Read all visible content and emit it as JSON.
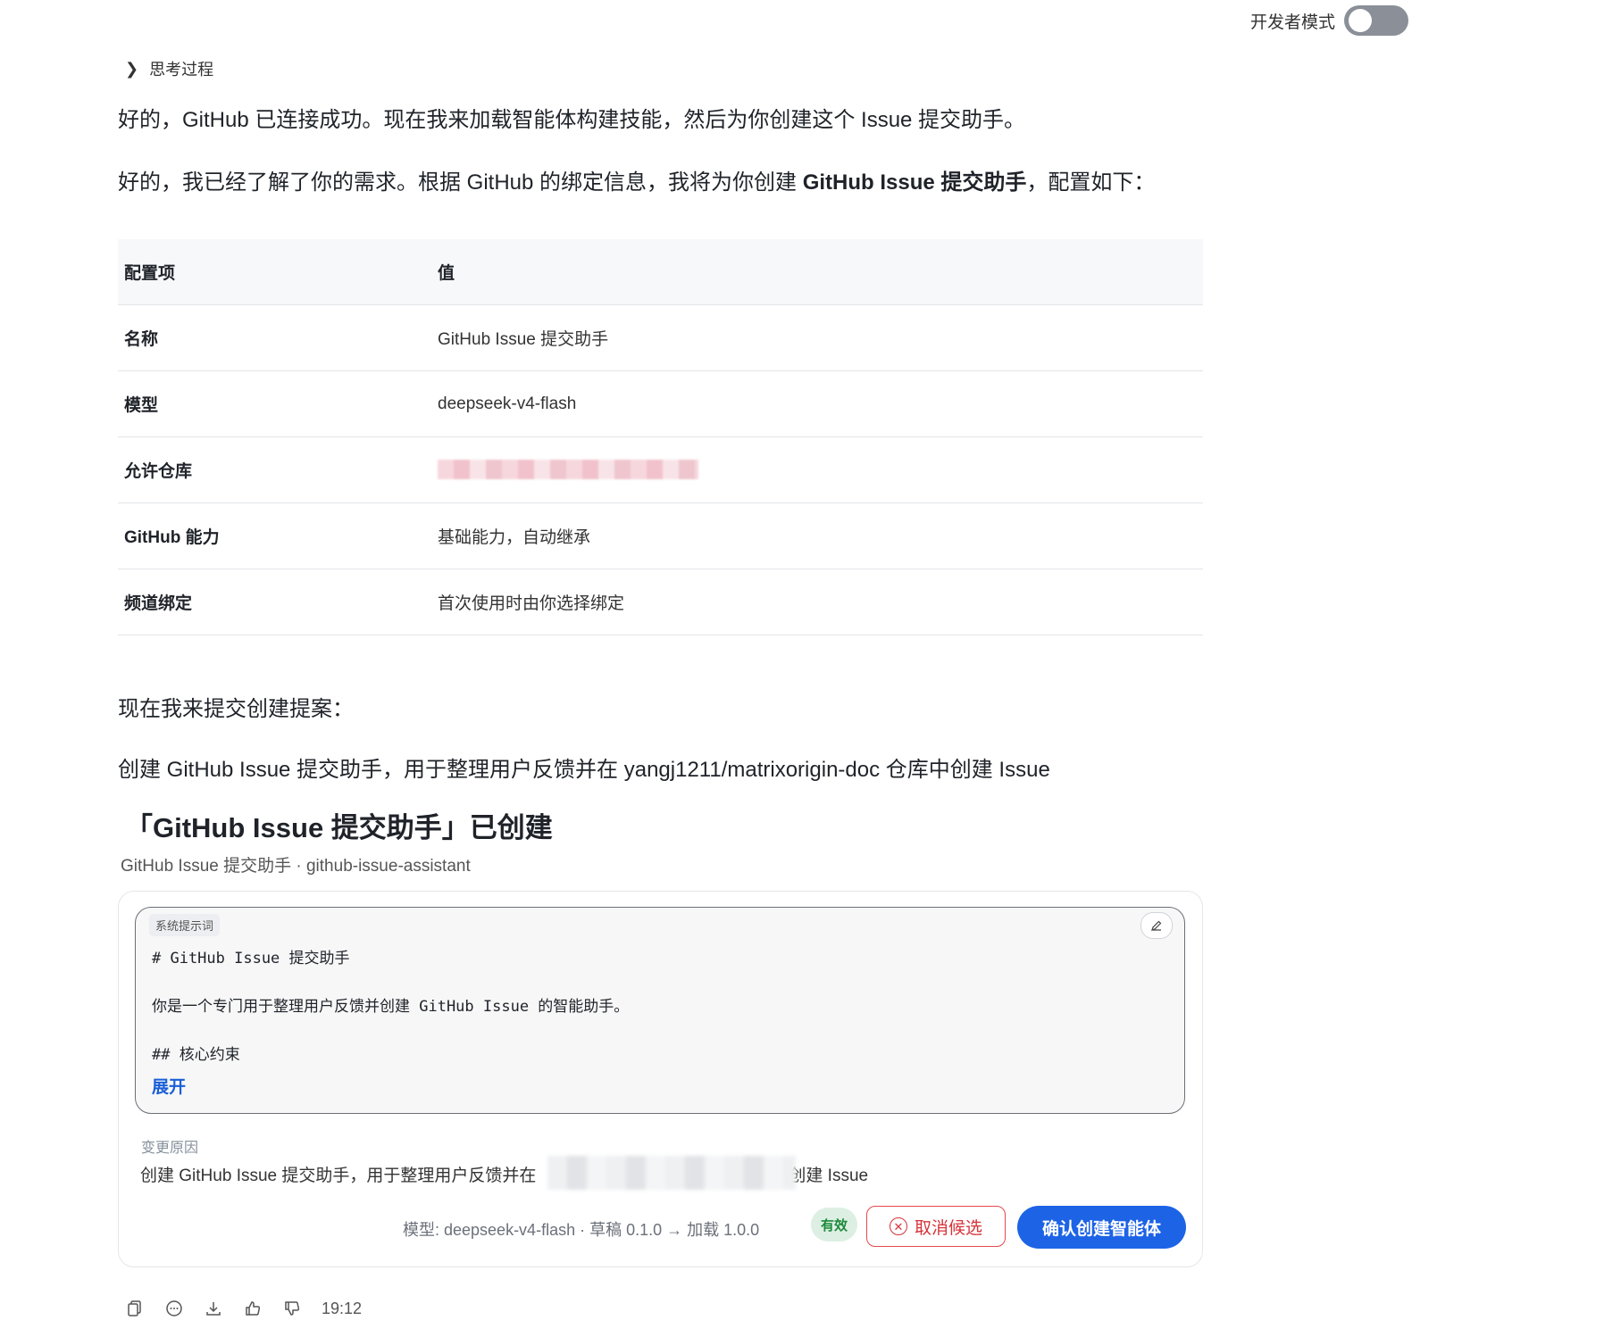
{
  "dev_mode": {
    "label": "开发者模式",
    "enabled": false
  },
  "thinking": {
    "label": "思考过程"
  },
  "messages": {
    "p1": "好的，GitHub 已连接成功。现在我来加载智能体构建技能，然后为你创建这个 Issue 提交助手。",
    "p2_prefix": "好的，我已经了解了你的需求。根据 GitHub 的绑定信息，我将为你创建 ",
    "p2_bold": "GitHub Issue 提交助手",
    "p2_suffix": "，配置如下：",
    "p3": "现在我来提交创建提案：",
    "p4": "创建 GitHub Issue 提交助手，用于整理用户反馈并在 yangj1211/matrixorigin-doc 仓库中创建 Issue"
  },
  "config_table": {
    "headers": [
      "配置项",
      "值"
    ],
    "rows": [
      {
        "key": "名称",
        "value": "GitHub Issue 提交助手"
      },
      {
        "key": "模型",
        "value": "deepseek-v4-flash"
      },
      {
        "key": "允许仓库",
        "value": ""
      },
      {
        "key": "GitHub 能力",
        "value": "基础能力，自动继承"
      },
      {
        "key": "频道绑定",
        "value": "首次使用时由你选择绑定"
      }
    ]
  },
  "agent_card": {
    "title": "「GitHub Issue 提交助手」已创建",
    "subtitle": "GitHub Issue 提交助手 · github-issue-assistant",
    "prompt_tag": "系统提示词",
    "prompt_lines": [
      "# GitHub Issue 提交助手",
      "你是一个专门用于整理用户反馈并创建 GitHub Issue 的智能助手。",
      "## 核心约束"
    ],
    "expand_label": "展开",
    "reason_label": "变更原因",
    "reason_prefix": "创建 GitHub Issue 提交助手，用于整理用户反馈并在",
    "reason_suffix": "库中创建 Issue",
    "meta": "模型: deepseek-v4-flash · 草稿 0.1.0 → 加载 1.0.0",
    "status_badge": "有效",
    "cancel_label": "取消候选",
    "confirm_label": "确认创建智能体",
    "edit_icon": "pencil-icon"
  },
  "footer": {
    "time": "19:12",
    "icons": [
      "copy-icon",
      "comment-icon",
      "download-icon",
      "thumbs-up-icon",
      "thumbs-down-icon"
    ]
  },
  "colors": {
    "primary": "#1d63e6",
    "danger": "#e5484d",
    "success_bg": "#ddefe3",
    "success_text": "#1c8a3b"
  }
}
